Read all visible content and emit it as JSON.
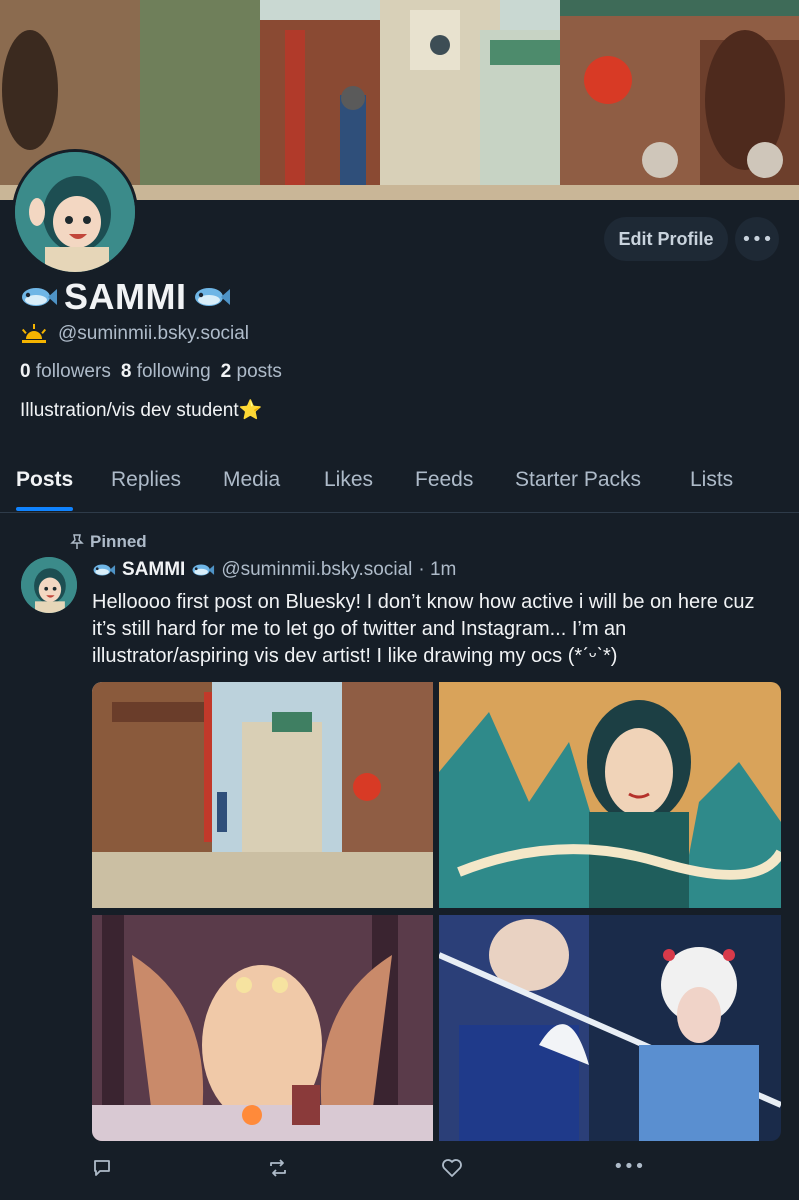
{
  "profile": {
    "display_name": "SAMMI",
    "handle": "@suminmii.bsky.social",
    "followers_count": "0",
    "followers_label": "followers",
    "following_count": "8",
    "following_label": "following",
    "posts_count": "2",
    "posts_label": "posts",
    "bio": "Illustration/vis dev student⭐",
    "edit_label": "Edit Profile",
    "more_label": "•••"
  },
  "tabs": [
    {
      "label": "Posts"
    },
    {
      "label": "Replies"
    },
    {
      "label": "Media"
    },
    {
      "label": "Likes"
    },
    {
      "label": "Feeds"
    },
    {
      "label": "Starter Packs"
    },
    {
      "label": "Lists"
    }
  ],
  "post": {
    "pinned_label": "Pinned",
    "author_name": "SAMMI",
    "author_handle": "@suminmii.bsky.social",
    "time": "· 1m",
    "text": "Helloooo first post on Bluesky! I don’t know how active i will be on here cuz it’s still hard for me to let go of twitter and Instagram... I’m an illustrator/aspiring vis dev artist! I like drawing my ocs (*ˊᵕˋ*)",
    "more_label": "•••"
  },
  "icons": {
    "fish": "fish-emoji-icon",
    "sunrise": "sunrise-emoji-icon",
    "pin": "pin-icon",
    "reply": "reply-icon",
    "repost": "repost-icon",
    "like": "heart-icon",
    "more": "more-dots-icon"
  },
  "colors": {
    "background": "#161e27",
    "accent": "#1083fe",
    "muted_text": "#aebbc9",
    "button_bg": "#1e2935"
  }
}
